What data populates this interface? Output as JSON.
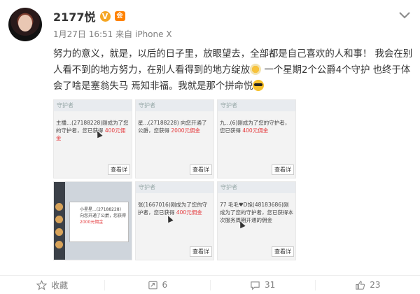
{
  "user": {
    "name": "2177悦",
    "vip_badge": "V"
  },
  "meta": {
    "date": "1月27日",
    "time": "16:51",
    "source_prefix": "来自",
    "device": "iPhone X"
  },
  "content": {
    "part1": "努力的意义，就是，以后的日子里，放眼望去，全部都是自己喜欢的人和事！ 我会在别人看不到的地方努力，在别人看得到的地方绽放",
    "part2": "  一个星期2个公爵4个守护 也终于体会了啥是塞翁失马 焉知非福。我就是那个拼命悦"
  },
  "images": [
    {
      "bar": "守护者",
      "text": "主播...(27188228)刚成为了您的守护者，您已获得",
      "amount": "400元佣金",
      "button": "查看详"
    },
    {
      "bar": "守护者",
      "text": "星...(27188228) 向您开通了公爵，您获得",
      "amount": "2000元佣金",
      "button": "查看详"
    },
    {
      "bar": "守护者",
      "text": "九...(6)刚成为了您的守护者，您已获得",
      "amount": "400元佣金",
      "button": "查看详"
    },
    {
      "bar": "",
      "text": "小星星...(27188228) 向您开通了公爵，您获得",
      "amount": "2000元佣金",
      "button": ""
    },
    {
      "bar": "守护者",
      "text": "张(1667016)刚成为了您的守护者，您已获得",
      "amount": "400元佣金",
      "button": "查看详"
    },
    {
      "bar": "守护者",
      "text": "77 毛毛♥D饱(48183686)刚成为了您的守护者，您已获得本次服务周期开通的佣金",
      "amount": "",
      "button": "查看详"
    }
  ],
  "actions": {
    "favorite": "收藏",
    "repost_count": "6",
    "comment_count": "31",
    "like_count": "23"
  },
  "colors": {
    "vip_orange": "#f5a623",
    "highlight_red": "#e4393c",
    "meta_gray": "#808080"
  }
}
